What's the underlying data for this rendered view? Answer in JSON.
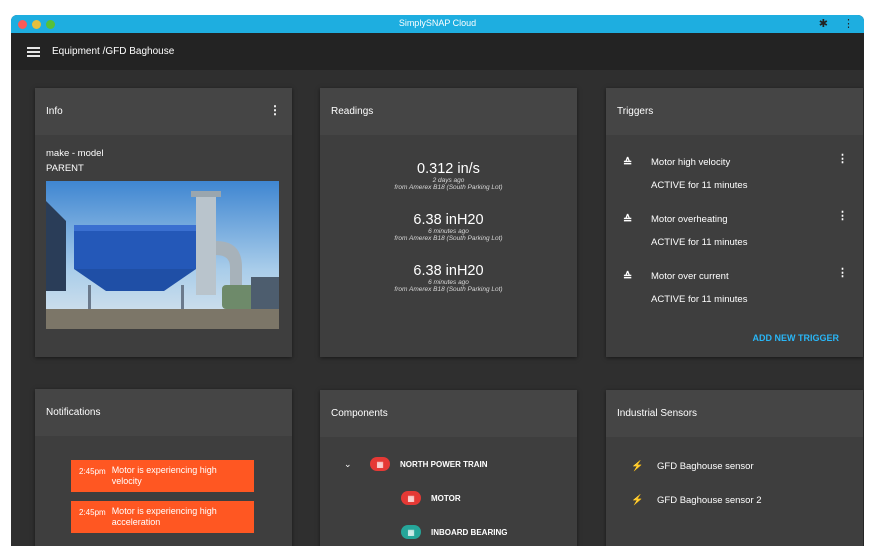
{
  "window": {
    "title": "SimplySNAP Cloud"
  },
  "appbar": {
    "breadcrumb": "Equipment /GFD Baghouse"
  },
  "info": {
    "title": "Info",
    "make_model": "make - model",
    "parent": "PARENT"
  },
  "readings": {
    "title": "Readings",
    "items": [
      {
        "value": "0.312 in/s",
        "ago": "2 days ago",
        "source": "from Amerex B18 (South Parking Lot)"
      },
      {
        "value": "6.38 inH20",
        "ago": "6 minutes ago",
        "source": "from Amerex B18 (South Parking Lot)"
      },
      {
        "value": "6.38 inH20",
        "ago": "6 minutes ago",
        "source": "from Amerex B18 (South Parking Lot)"
      }
    ]
  },
  "triggers": {
    "title": "Triggers",
    "items": [
      {
        "name": "Motor high velocity",
        "status": "ACTIVE for 11 minutes"
      },
      {
        "name": "Motor overheating",
        "status": "ACTIVE for 11 minutes"
      },
      {
        "name": "Motor over current",
        "status": "ACTIVE for 11 minutes"
      }
    ],
    "add_label": "ADD NEW TRIGGER"
  },
  "notifications": {
    "title": "Notifications",
    "items": [
      {
        "time": "2:45pm",
        "message": "Motor is experiencing high velocity"
      },
      {
        "time": "2:45pm",
        "message": "Motor is experiencing high acceleration"
      }
    ]
  },
  "components": {
    "title": "Components",
    "items": [
      {
        "label": "NORTH POWER TRAIN",
        "badge_color": "#e53935"
      },
      {
        "label": "MOTOR",
        "badge_color": "#e53935"
      },
      {
        "label": "INBOARD BEARING",
        "badge_color": "#26a69a"
      }
    ]
  },
  "sensors": {
    "title": "Industrial Sensors",
    "items": [
      {
        "name": "GFD Baghouse sensor"
      },
      {
        "name": "GFD Baghouse sensor 2"
      }
    ]
  },
  "colors": {
    "accent": "#1eaee0",
    "link": "#29b6f6",
    "alert": "#ff5722",
    "card": "#3e3e3e",
    "background": "#2f2f2f"
  }
}
